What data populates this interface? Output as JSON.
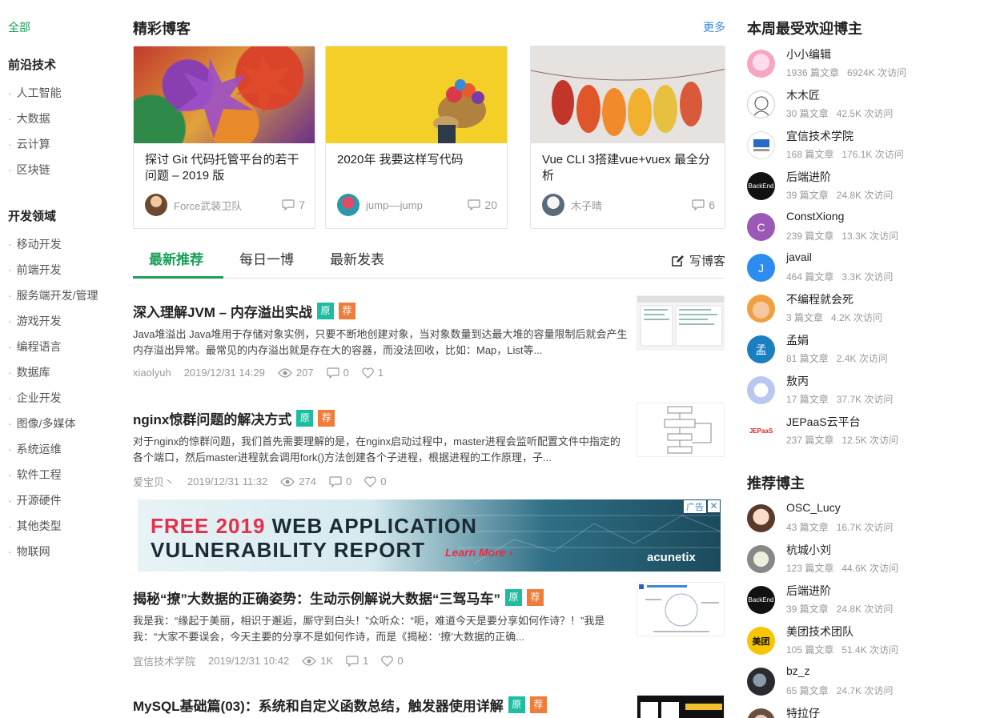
{
  "sidebar": {
    "all": "全部",
    "group1": "前沿技术",
    "group1_items": [
      "人工智能",
      "大数据",
      "云计算",
      "区块链"
    ],
    "group2": "开发领域",
    "group2_items": [
      "移动开发",
      "前端开发",
      "服务端开发/管理",
      "游戏开发",
      "编程语言",
      "数据库",
      "企业开发",
      "图像/多媒体",
      "系统运维",
      "软件工程",
      "开源硬件",
      "其他类型",
      "物联网"
    ]
  },
  "featured": {
    "title": "精彩博客",
    "more": "更多",
    "cards": [
      {
        "title": "探讨 Git 代码托管平台的若干问题 – 2019 版",
        "author": "Force武装卫队",
        "comments": "7"
      },
      {
        "title": "2020年 我要这样写代码",
        "author": "jump––jump",
        "comments": "20"
      },
      {
        "title": "Vue CLI 3搭建vue+vuex 最全分析",
        "author": "木子晴",
        "comments": "6"
      }
    ]
  },
  "tabs": {
    "items": [
      "最新推荐",
      "每日一博",
      "最新发表"
    ],
    "write": "写博客"
  },
  "articles": [
    {
      "title": "深入理解JVM – 内存溢出实战",
      "badge1": "原",
      "badge2": "荐",
      "summary": "Java堆溢出 Java堆用于存储对象实例，只要不断地创建对象，当对象数量到达最大堆的容量限制后就会产生内存溢出异常。最常见的内存溢出就是存在大的容器，而没法回收，比如：Map，List等...",
      "author": "xiaolyuh",
      "date": "2019/12/31 14:29",
      "views": "207",
      "comments": "0",
      "likes": "1"
    },
    {
      "title": "nginx惊群问题的解决方式",
      "badge1": "原",
      "badge2": "荐",
      "summary": "对于nginx的惊群问题，我们首先需要理解的是，在nginx启动过程中，master进程会监听配置文件中指定的各个端口，然后master进程就会调用fork()方法创建各个子进程，根据进程的工作原理，子...",
      "author": "爱宝贝丶",
      "date": "2019/12/31 11:32",
      "views": "274",
      "comments": "0",
      "likes": "0"
    },
    {
      "title": "揭秘“撩”大数据的正确姿势：生动示例解说大数据“三驾马车”",
      "badge1": "原",
      "badge2": "荐",
      "summary": "我是我：“缘起于美丽，相识于邂逅，厮守到白头！”众听众：“呃，难道今天是要分享如何作诗？！”我是我：“大家不要误会，今天主要的分享不是如何作诗，而是《揭秘：‘撩’大数据的正确...",
      "author": "宜信技术学院",
      "date": "2019/12/31 10:42",
      "views": "1K",
      "comments": "1",
      "likes": "0"
    },
    {
      "title": "MySQL基础篇(03)：系统和自定义函数总结，触发器使用详解",
      "badge1": "原",
      "badge2": "荐"
    }
  ],
  "ad": {
    "line1_red": "FREE 2019",
    "line1": "WEB APPLICATION",
    "line2": "VULNERABILITY REPORT",
    "learn": "Learn More ›",
    "brand": "acunetix",
    "tag": "广告",
    "close": "✕"
  },
  "popular": {
    "title": "本周最受欢迎博主",
    "items": [
      {
        "name": "小小编辑",
        "articles": "1936 篇文章",
        "visits": "6924K 次访问"
      },
      {
        "name": "木木匠",
        "articles": "30 篇文章",
        "visits": "42.5K 次访问"
      },
      {
        "name": "宜信技术学院",
        "articles": "168 篇文章",
        "visits": "176.1K 次访问"
      },
      {
        "name": "后端进阶",
        "articles": "39 篇文章",
        "visits": "24.8K 次访问"
      },
      {
        "name": "ConstXiong",
        "articles": "239 篇文章",
        "visits": "13.3K 次访问"
      },
      {
        "name": "javail",
        "articles": "464 篇文章",
        "visits": "3.3K 次访问"
      },
      {
        "name": "不编程就会死",
        "articles": "3 篇文章",
        "visits": "4.2K 次访问"
      },
      {
        "name": "孟娟",
        "articles": "81 篇文章",
        "visits": "2.4K 次访问"
      },
      {
        "name": "敖丙",
        "articles": "17 篇文章",
        "visits": "37.7K 次访问"
      },
      {
        "name": "JEPaaS云平台",
        "articles": "237 篇文章",
        "visits": "12.5K 次访问"
      }
    ]
  },
  "recommended": {
    "title": "推荐博主",
    "items": [
      {
        "name": "OSC_Lucy",
        "articles": "43 篇文章",
        "visits": "16.7K 次访问"
      },
      {
        "name": "杭城小刘",
        "articles": "123 篇文章",
        "visits": "44.6K 次访问"
      },
      {
        "name": "后端进阶",
        "articles": "39 篇文章",
        "visits": "24.8K 次访问"
      },
      {
        "name": "美团技术团队",
        "articles": "105 篇文章",
        "visits": "51.4K 次访问"
      },
      {
        "name": "bz_z",
        "articles": "65 篇文章",
        "visits": "24.7K 次访问"
      },
      {
        "name": "特拉仔",
        "articles": "",
        "visits": ""
      }
    ]
  },
  "avatar_letters": {
    "constxiong": "C",
    "javail": "J",
    "mengjuan": "孟",
    "backend": "BackEnd",
    "jepaas": "JEPaaS",
    "meituan": "美团"
  },
  "colors": {
    "accent": "#18a058",
    "badge_yuan": "#1ebca1",
    "badge_jian": "#f07c3a",
    "link": "#3a8bd4"
  }
}
